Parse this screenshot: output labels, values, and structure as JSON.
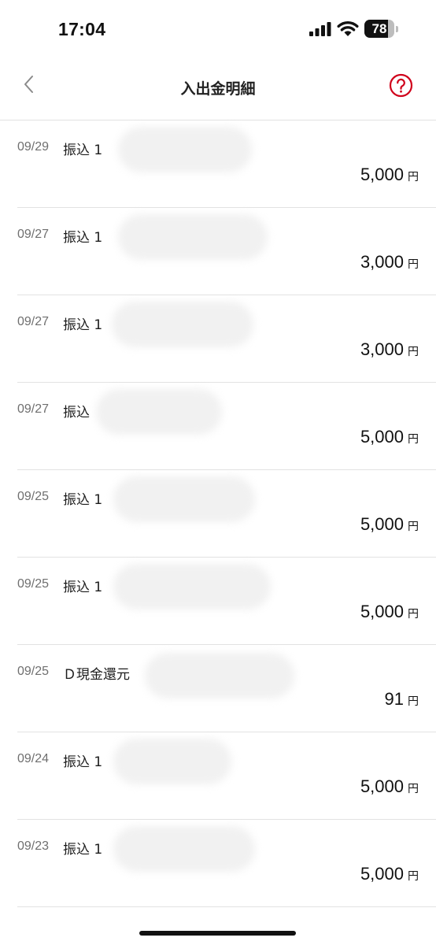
{
  "status_bar": {
    "time": "17:04",
    "battery_level": "78",
    "icons": [
      "signal-icon",
      "wifi-icon",
      "battery-icon"
    ]
  },
  "nav": {
    "title": "入出金明細",
    "back_icon": "chevron-left-icon",
    "help_icon": "question-circle-icon",
    "accent_color": "#d0021b"
  },
  "currency_unit": "円",
  "transactions": [
    {
      "date": "09/29",
      "description": "振込 1",
      "amount": "5,000"
    },
    {
      "date": "09/27",
      "description": "振込 1",
      "amount": "3,000"
    },
    {
      "date": "09/27",
      "description": "振込 1",
      "amount": "3,000"
    },
    {
      "date": "09/27",
      "description": "振込",
      "amount": "5,000"
    },
    {
      "date": "09/25",
      "description": "振込 1",
      "amount": "5,000"
    },
    {
      "date": "09/25",
      "description": "振込 1",
      "amount": "5,000"
    },
    {
      "date": "09/25",
      "description": "Ｄ現金還元",
      "amount": "91"
    },
    {
      "date": "09/24",
      "description": "振込 1",
      "amount": "5,000"
    },
    {
      "date": "09/23",
      "description": "振込 1",
      "amount": "5,000"
    }
  ]
}
